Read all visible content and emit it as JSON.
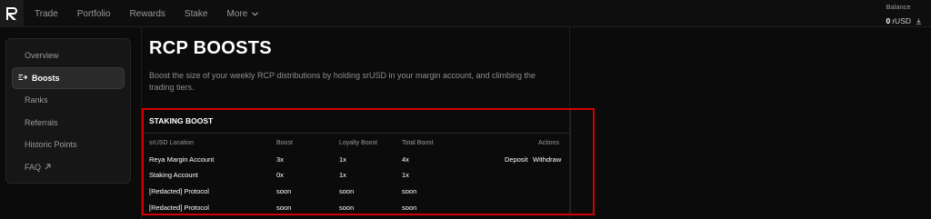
{
  "nav": {
    "items": [
      "Trade",
      "Portfolio",
      "Rewards",
      "Stake",
      "More"
    ]
  },
  "balance": {
    "label": "Balance",
    "value": "0",
    "unit": "rUSD"
  },
  "sidebar": {
    "items": [
      {
        "label": "Overview"
      },
      {
        "label": "Boosts"
      },
      {
        "label": "Ranks"
      },
      {
        "label": "Referrals"
      },
      {
        "label": "Historic Points"
      },
      {
        "label": "FAQ"
      }
    ]
  },
  "page": {
    "title": "RCP BOOSTS",
    "description": "Boost the size of your weekly RCP distributions by holding srUSD in your margin account, and climbing the trading tiers."
  },
  "staking": {
    "title": "STAKING BOOST",
    "headers": [
      "srUSD Location",
      "Boost",
      "Loyalty Boost",
      "Total Boost",
      "Actions"
    ],
    "rows": [
      {
        "location": "Reya Margin Account",
        "boost": "3x",
        "loyalty": "1x",
        "total": "4x",
        "deposit": "Deposit",
        "withdraw": "Withdraw"
      },
      {
        "location": "Staking Account",
        "boost": "0x",
        "loyalty": "1x",
        "total": "1x"
      },
      {
        "location": "[Redacted] Protocol",
        "boost": "soon",
        "loyalty": "soon",
        "total": "soon"
      },
      {
        "location": "[Redacted] Protocol",
        "boost": "soon",
        "loyalty": "soon",
        "total": "soon"
      }
    ]
  },
  "colors": {
    "accent_outline": "#d40000",
    "background": "#0b0b0b"
  }
}
